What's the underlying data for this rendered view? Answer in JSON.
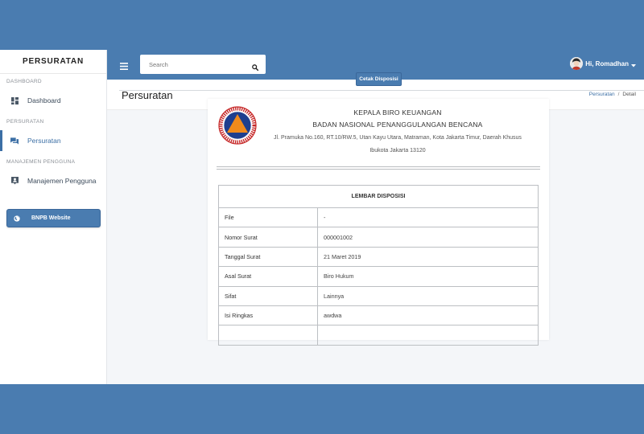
{
  "sidebar": {
    "brand": "PERSURATAN",
    "sections": [
      {
        "label": "DASHBOARD",
        "item": "Dashboard"
      },
      {
        "label": "PERSURATAN",
        "item": "Persuratan"
      },
      {
        "label": "MANAJEMEN PENGGUNA",
        "item": "Manajemen Pengguna"
      }
    ],
    "website_button": "BNPB Website"
  },
  "topbar": {
    "search_placeholder": "Search",
    "user_greeting": "Hi, Romadhan"
  },
  "header": {
    "title": "Persuratan",
    "breadcrumb": [
      "Persuratan",
      "Detail"
    ]
  },
  "content": {
    "print_button": "Cetak Disposisi",
    "letterhead": {
      "line1": "KEPALA BIRO KEUANGAN",
      "line2": "BADAN NASIONAL PENANGGULANGAN BENCANA",
      "address_line1": "Jl. Pramuka No.160, RT.10/RW.5, Utan Kayu Utara, Matraman, Kota Jakarta Timur, Daerah Khusus",
      "address_line2": "Ibukota Jakarta 13120"
    },
    "table": {
      "title": "LEMBAR DISPOSISI",
      "rows": [
        {
          "key": "File",
          "value": "-"
        },
        {
          "key": "Nomor Surat",
          "value": "000001002"
        },
        {
          "key": "Tanggal Surat",
          "value": "21 Maret 2019"
        },
        {
          "key": "Asal Surat",
          "value": "Biro Hukum"
        },
        {
          "key": "Sifat",
          "value": "Lainnya"
        },
        {
          "key": "Isi Ringkas",
          "value": "awdwa"
        }
      ]
    }
  },
  "colors": {
    "primary": "#4a7cb0",
    "logo_orange": "#f08a1c",
    "logo_blue": "#1e3f8f",
    "logo_red": "#c62828"
  }
}
